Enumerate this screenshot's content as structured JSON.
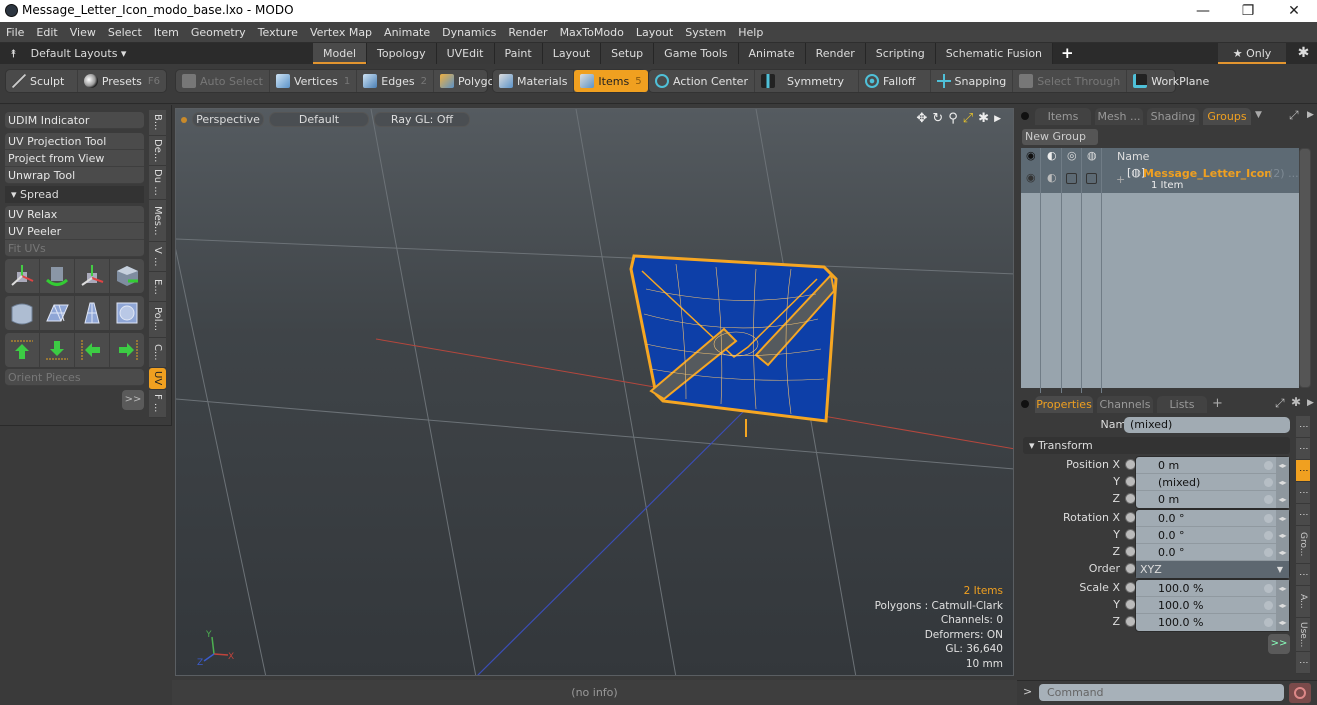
{
  "window": {
    "title": "Message_Letter_Icon_modo_base.lxo - MODO",
    "controls": {
      "minimize": "—",
      "maximize": "❐",
      "close": "✕"
    }
  },
  "menu": [
    "File",
    "Edit",
    "View",
    "Select",
    "Item",
    "Geometry",
    "Texture",
    "Vertex Map",
    "Animate",
    "Dynamics",
    "Render",
    "MaxToModo",
    "Layout",
    "System",
    "Help"
  ],
  "layoutbar": {
    "default_layouts": "Default Layouts ▾",
    "tabs": [
      "Model",
      "Topology",
      "UVEdit",
      "Paint",
      "Layout",
      "Setup",
      "Game Tools",
      "Animate",
      "Render",
      "Scripting",
      "Schematic Fusion"
    ],
    "active_tab": "Model",
    "add": "+",
    "only": "★ Only"
  },
  "toolbar": {
    "sculpt": "Sculpt",
    "presets": "Presets",
    "presets_key": "F6",
    "auto_select": "Auto Select",
    "vertices": "Vertices",
    "vertices_key": "1",
    "edges": "Edges",
    "edges_key": "2",
    "polygons": "Polygons",
    "materials": "Materials",
    "items": "Items",
    "items_key": "5",
    "action_center": "Action Center",
    "symmetry": "Symmetry",
    "falloff": "Falloff",
    "snapping": "Snapping",
    "select_through": "Select Through",
    "workplane": "WorkPlane"
  },
  "leftpanel": {
    "udim": "UDIM Indicator",
    "uv_projection": "UV Projection Tool",
    "project_view": "Project from View",
    "unwrap": "Unwrap Tool",
    "spread": "▾ Spread",
    "uv_relax": "UV Relax",
    "uv_peeler": "UV Peeler",
    "fit_uvs": "Fit UVs",
    "orient_pieces": "Orient Pieces",
    "more": ">>",
    "vtabs": [
      "B...",
      "De...",
      "Du ...",
      "Mes...",
      "V ...",
      "E...",
      "Pol...",
      "C...",
      "UV",
      "F ..."
    ],
    "active_vtab": "UV"
  },
  "viewport": {
    "view": "Perspective",
    "shading": "Default",
    "raygl": "Ray GL: Off",
    "info": {
      "items": "2 Items",
      "polygons": "Polygons : Catmull-Clark",
      "channels": "Channels: 0",
      "deformers": "Deformers: ON",
      "gl": "GL: 36,640",
      "scale": "10 mm"
    },
    "axis": {
      "y": "Y",
      "x": "X",
      "z": "Z"
    }
  },
  "statusbar": "(no info)",
  "groups_panel": {
    "tabs": [
      "Items",
      "Mesh ...",
      "Shading",
      "Groups"
    ],
    "active_tab": "Groups",
    "new_group": "New Group",
    "name_header": "Name",
    "group_name": "Message_Letter_Icon",
    "group_count": "(2) ...",
    "group_sub": "1 Item"
  },
  "properties": {
    "tabs": [
      "Properties",
      "Channels",
      "Lists"
    ],
    "active_tab": "Properties",
    "add": "+",
    "name_label": "Name",
    "name_value": "(mixed)",
    "transform": "▾ Transform",
    "position": {
      "label_x": "Position X",
      "x": "0 m",
      "y": "(mixed)",
      "z": "0 m"
    },
    "rotation": {
      "label_x": "Rotation X",
      "x": "0.0 °",
      "y": "0.0 °",
      "z": "0.0 °"
    },
    "order": {
      "label": "Order",
      "value": "XYZ"
    },
    "scale": {
      "label_x": "Scale X",
      "x": "100.0 %",
      "y": "100.0 %",
      "z": "100.0 %"
    },
    "axis_y": "Y",
    "axis_z": "Z",
    "more": ">>",
    "vtabs": [
      "⋮",
      "⋮",
      "⋮",
      "⋮",
      "⋮",
      "Gro...",
      "⋮",
      "A...",
      "Use...",
      "⋮"
    ]
  },
  "command": {
    "prompt": ">",
    "placeholder": "Command"
  },
  "colors": {
    "accent": "#f0a020",
    "mesh_fill": "#0d3fa8",
    "wire": "#f5a623"
  }
}
